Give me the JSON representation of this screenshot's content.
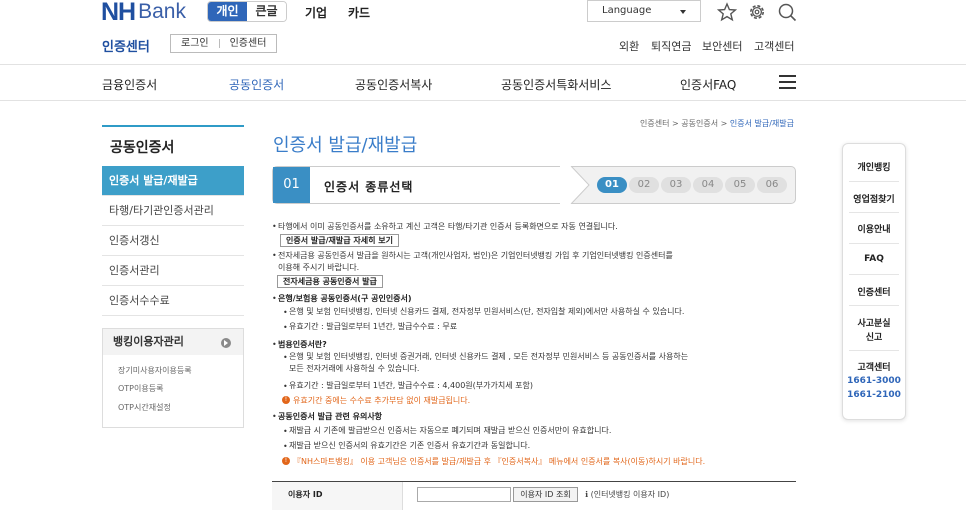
{
  "header": {
    "logo_nh": "NH",
    "logo_bank": "Bank",
    "user_types": [
      "개인",
      "큰글"
    ],
    "top_nav": [
      "기업",
      "카드"
    ],
    "language_label": "Language",
    "section_title": "인증센터",
    "section_buttons": [
      "로그인",
      "인증센터"
    ],
    "utility_links": [
      "외환",
      "퇴직연금",
      "보안센터",
      "고객센터"
    ]
  },
  "gnb": {
    "items": [
      "금융인증서",
      "공동인증서",
      "공동인증서복사",
      "공동인증서특화서비스",
      "인증서FAQ"
    ],
    "active_index": 1
  },
  "sidebar": {
    "title": "공동인증서",
    "items": [
      "인증서 발급/재발급",
      "타행/타기관인증서관리",
      "인증서갱신",
      "인증서관리",
      "인증서수수료"
    ],
    "active_index": 0,
    "banking": {
      "title": "뱅킹이용자관리",
      "links": [
        "장기미사용자이용등록",
        "OTP이용등록",
        "OTP시간재설정"
      ]
    }
  },
  "breadcrumb": [
    "인증센터",
    "공동인증서",
    "인증서 발급/재발급"
  ],
  "page_title": "인증서 발급/재발급",
  "steps": {
    "current_num": "01",
    "current_label": "인증서 종류선택",
    "all": [
      "01",
      "02",
      "03",
      "04",
      "05",
      "06"
    ],
    "active_index": 0
  },
  "content": {
    "p1_line1": "타행에서 이미 공동인증서를 소유하고 계신 고객은 타행/타기관 인증서 등록화면으로 자동 연결됩니다.",
    "p1_button": "인증서 발급/재발급 자세히 보기",
    "p2_line1": "전자세금용 공동인증서 발급을 원하시는 고객(개인사업자, 법인)은 기업인터넷뱅킹 가입 후 기업인터넷뱅킹 인증센터를",
    "p2_line2": "이용해 주시기 바랍니다.",
    "p2_button": "전자세금용 공동인증서 발급",
    "s1_head": "은행/보험용 공동인증서(구 공인인증서)",
    "s1_b1": "은행 및 보험 인터넷뱅킹, 인터넷 신용카드 결제, 전자정부 민원서비스(단, 전자입찰 제외)에서만 사용하실 수 있습니다.",
    "s1_b2": "유효기간 : 발급일로부터 1년간, 발급수수료 : 무료",
    "s2_head": "범용인증서란?",
    "s2_b1_l1": "은행 및 보험 인터넷뱅킹, 인터넷 증권거래, 인터넷 신용카드 결제 , 모든 전자정부 민원서비스 등 공동인증서를 사용하는",
    "s2_b1_l2": "모든 전자거래에 사용하실 수 있습니다.",
    "s2_b2": "유효기간 : 발급일로부터 1년간, 발급수수료 : 4,400원(부가가치세 포함)",
    "s2_warn": "유효기간 중에는 수수료 추가부담 없이 재발급됩니다.",
    "s3_head": "공동인증서 발급 관련 유의사항",
    "s3_b1": "재발급 시 기존에 발급받으신 인증서는 자동으로 폐기되며 재발급 받으신 인증서만이 유효합니다.",
    "s3_b2": "재발급 받으신 인증서의 유효기간은 기존 인증서 유효기간과 동일합니다.",
    "s3_warn": "『NH스마트뱅킹』 이용 고객님은 인증서를 발급/재발급 후 『인증서복사』 메뉴에서 인증서를 복사(이동)하시기 바랍니다."
  },
  "form": {
    "label": "이용자 ID",
    "input_value": "",
    "button": "이용자 ID 조회",
    "note": "(인터넷뱅킹 이용자 ID)"
  },
  "quick_menu": {
    "items": [
      "개인뱅킹",
      "영업점찾기",
      "이용안내",
      "FAQ",
      "인증센터",
      "사고분실",
      "신고",
      "고객센터"
    ],
    "phones": [
      "1661-3000",
      "1661-2100"
    ]
  },
  "colors": {
    "brand": "#1f4fa0",
    "accent": "#3a8fc4",
    "warning": "#e2661a"
  }
}
